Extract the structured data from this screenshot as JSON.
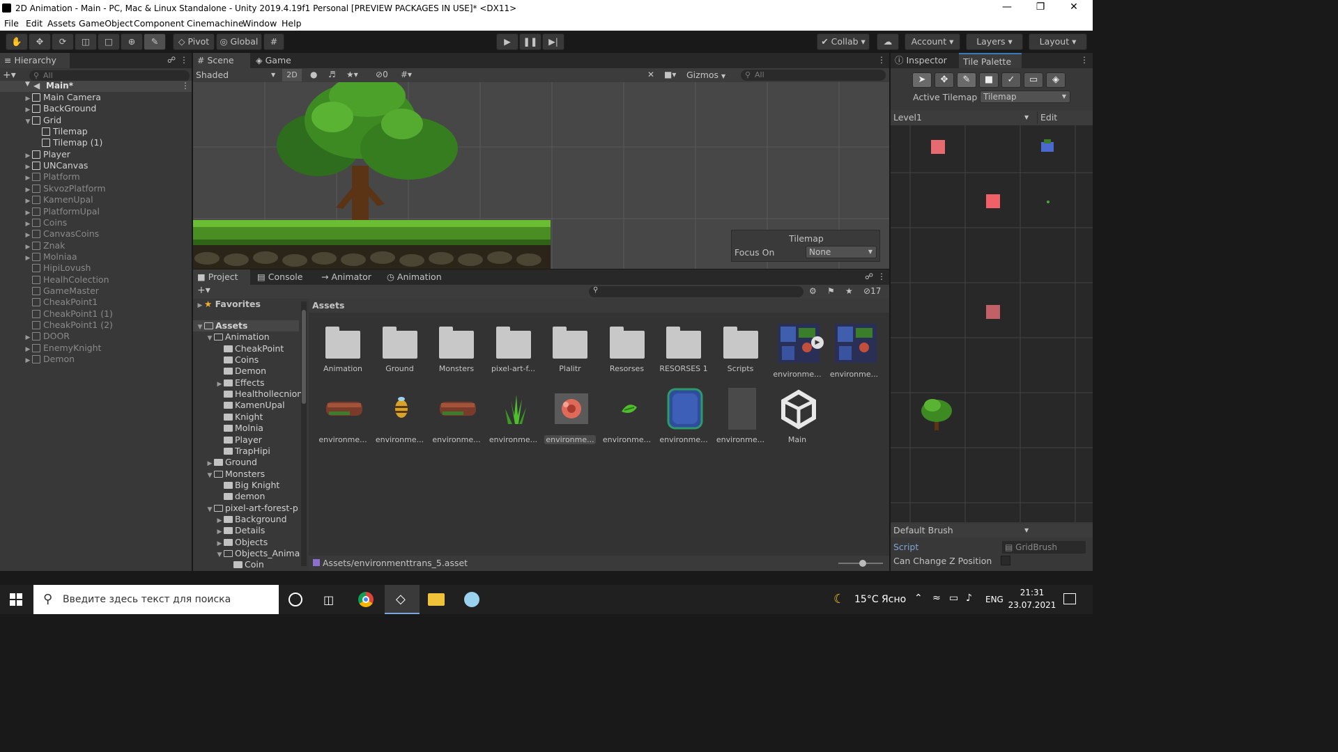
{
  "window": {
    "title": "2D Animation - Main - PC, Mac & Linux Standalone - Unity 2019.4.19f1 Personal [PREVIEW PACKAGES IN USE]* <DX11>"
  },
  "menu": [
    "File",
    "Edit",
    "Assets",
    "GameObject",
    "Component",
    "Cinemachine",
    "Window",
    "Help"
  ],
  "toolbar": {
    "pivot": "Pivot",
    "global": "Global",
    "collab": "Collab",
    "account": "Account",
    "layers": "Layers",
    "layout": "Layout"
  },
  "hierarchy": {
    "tab": "Hierarchy",
    "search_placeholder": "All",
    "scene": "Main*",
    "items": [
      {
        "label": "Main Camera",
        "indent": 1,
        "expander": "collapsed",
        "dim": false
      },
      {
        "label": "BackGround",
        "indent": 1,
        "expander": "collapsed",
        "dim": false
      },
      {
        "label": "Grid",
        "indent": 1,
        "expander": "expanded",
        "dim": false
      },
      {
        "label": "Tilemap",
        "indent": 2,
        "expander": "none",
        "dim": false
      },
      {
        "label": "Tilemap (1)",
        "indent": 2,
        "expander": "none",
        "dim": false
      },
      {
        "label": "Player",
        "indent": 1,
        "expander": "collapsed",
        "dim": false
      },
      {
        "label": "UNCanvas",
        "indent": 1,
        "expander": "collapsed",
        "dim": false
      },
      {
        "label": "Platform",
        "indent": 1,
        "expander": "collapsed",
        "dim": true
      },
      {
        "label": "SkvozPlatform",
        "indent": 1,
        "expander": "collapsed",
        "dim": true
      },
      {
        "label": "KamenUpal",
        "indent": 1,
        "expander": "collapsed",
        "dim": true
      },
      {
        "label": "PlatformUpal",
        "indent": 1,
        "expander": "collapsed",
        "dim": true
      },
      {
        "label": "Coins",
        "indent": 1,
        "expander": "collapsed",
        "dim": true
      },
      {
        "label": "CanvasCoins",
        "indent": 1,
        "expander": "collapsed",
        "dim": true
      },
      {
        "label": "Znak",
        "indent": 1,
        "expander": "collapsed",
        "dim": true
      },
      {
        "label": "Molniaa",
        "indent": 1,
        "expander": "collapsed",
        "dim": true
      },
      {
        "label": "HipiLovush",
        "indent": 1,
        "expander": "none",
        "dim": true
      },
      {
        "label": "HealhColection",
        "indent": 1,
        "expander": "none",
        "dim": true
      },
      {
        "label": "GameMaster",
        "indent": 1,
        "expander": "none",
        "dim": true
      },
      {
        "label": "CheakPoint1",
        "indent": 1,
        "expander": "none",
        "dim": true
      },
      {
        "label": "CheakPoint1 (1)",
        "indent": 1,
        "expander": "none",
        "dim": true
      },
      {
        "label": "CheakPoint1 (2)",
        "indent": 1,
        "expander": "none",
        "dim": true
      },
      {
        "label": "DOOR",
        "indent": 1,
        "expander": "collapsed",
        "dim": true
      },
      {
        "label": "EnemyKnight",
        "indent": 1,
        "expander": "collapsed",
        "dim": true
      },
      {
        "label": "Demon",
        "indent": 1,
        "expander": "collapsed",
        "dim": true
      }
    ]
  },
  "scene": {
    "tabs": [
      "Scene",
      "Game"
    ],
    "shading": "Shaded",
    "mode_2d": "2D",
    "hidden_count": "0",
    "gizmos": "Gizmos",
    "search_placeholder": "All",
    "overlay": {
      "title": "Tilemap",
      "focus_label": "Focus On",
      "focus_value": "None"
    }
  },
  "project": {
    "tabs": [
      "Project",
      "Console",
      "Animator",
      "Animation"
    ],
    "hidden_count": "17",
    "favorites": "Favorites",
    "tree": [
      {
        "label": "Assets",
        "depth": 0,
        "expander": "expanded"
      },
      {
        "label": "Animation",
        "depth": 1,
        "expander": "expanded"
      },
      {
        "label": "CheakPoint",
        "depth": 2,
        "expander": "none"
      },
      {
        "label": "Coins",
        "depth": 2,
        "expander": "none"
      },
      {
        "label": "Demon",
        "depth": 2,
        "expander": "none"
      },
      {
        "label": "Effects",
        "depth": 2,
        "expander": "collapsed"
      },
      {
        "label": "Healthollecnion",
        "depth": 2,
        "expander": "none"
      },
      {
        "label": "KamenUpal",
        "depth": 2,
        "expander": "none"
      },
      {
        "label": "Knight",
        "depth": 2,
        "expander": "none"
      },
      {
        "label": "Molnia",
        "depth": 2,
        "expander": "none"
      },
      {
        "label": "Player",
        "depth": 2,
        "expander": "none"
      },
      {
        "label": "TrapHipi",
        "depth": 2,
        "expander": "none"
      },
      {
        "label": "Ground",
        "depth": 1,
        "expander": "collapsed"
      },
      {
        "label": "Monsters",
        "depth": 1,
        "expander": "expanded"
      },
      {
        "label": "Big Knight",
        "depth": 2,
        "expander": "none"
      },
      {
        "label": "demon",
        "depth": 2,
        "expander": "none"
      },
      {
        "label": "pixel-art-forest-p",
        "depth": 1,
        "expander": "expanded"
      },
      {
        "label": "Background",
        "depth": 2,
        "expander": "collapsed"
      },
      {
        "label": "Details",
        "depth": 2,
        "expander": "collapsed"
      },
      {
        "label": "Objects",
        "depth": 2,
        "expander": "collapsed"
      },
      {
        "label": "Objects_Anima",
        "depth": 2,
        "expander": "expanded"
      },
      {
        "label": "Coin",
        "depth": 3,
        "expander": "none"
      }
    ],
    "breadcrumb": "Assets",
    "assets_row1": [
      {
        "label": "Animation",
        "kind": "folder"
      },
      {
        "label": "Ground",
        "kind": "folder"
      },
      {
        "label": "Monsters",
        "kind": "folder"
      },
      {
        "label": "pixel-art-f...",
        "kind": "folder"
      },
      {
        "label": "Plalitr",
        "kind": "folder"
      },
      {
        "label": "Resorses",
        "kind": "folder"
      },
      {
        "label": "RESORSES 1",
        "kind": "folder"
      },
      {
        "label": "Scripts",
        "kind": "folder"
      },
      {
        "label": "environme...",
        "kind": "tileset"
      },
      {
        "label": "environme...",
        "kind": "tileset"
      }
    ],
    "assets_row2": [
      {
        "label": "environme...",
        "kind": "log"
      },
      {
        "label": "environme...",
        "kind": "bee"
      },
      {
        "label": "environme...",
        "kind": "log"
      },
      {
        "label": "environme...",
        "kind": "grass"
      },
      {
        "label": "environme...",
        "kind": "flower",
        "selected": true
      },
      {
        "label": "environme...",
        "kind": "leaf"
      },
      {
        "label": "environme...",
        "kind": "water"
      },
      {
        "label": "environme...",
        "kind": "blank"
      },
      {
        "label": "Main",
        "kind": "unity"
      }
    ],
    "status_path": "Assets/environmenttrans_5.asset"
  },
  "inspector": {
    "tabs": [
      "Inspector",
      "Tile Palette"
    ],
    "active_tilemap_label": "Active Tilemap",
    "active_tilemap_value": "Tilemap",
    "palette": "Level1",
    "edit": "Edit",
    "brush": "Default Brush",
    "script_label": "Script",
    "script_value": "GridBrush",
    "can_change_z": "Can Change Z Position"
  },
  "taskbar": {
    "search_placeholder": "Введите здесь текст для поиска",
    "weather": "15°C Ясно",
    "lang": "ENG",
    "time": "21:31",
    "date": "23.07.2021"
  },
  "colors": {
    "accent_blue": "#3a79bb",
    "panel_bg": "#383838",
    "selection": "#2c5d87"
  }
}
